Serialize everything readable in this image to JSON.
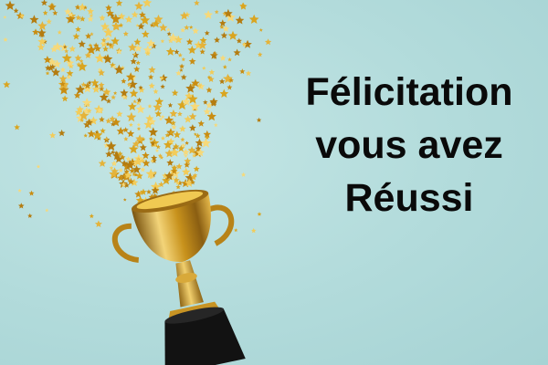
{
  "headline": {
    "line1": "Félicitation",
    "line2": "vous avez",
    "line3": "Réussi"
  },
  "colors": {
    "background": "#b7dede",
    "text": "#0a0a0a",
    "gold": "#d9a520",
    "trophy_base": "#121212"
  },
  "icons": {
    "trophy": "trophy-icon",
    "confetti": "star-confetti"
  }
}
